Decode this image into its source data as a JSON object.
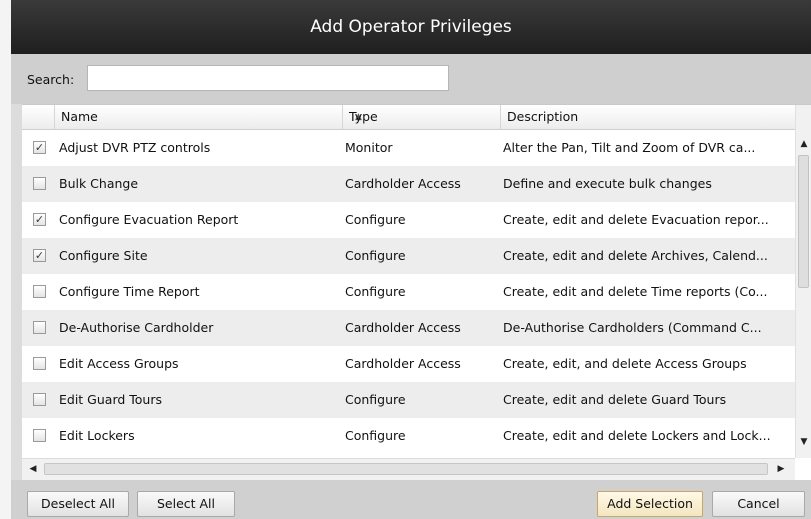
{
  "dialog": {
    "title": "Add Operator Privileges",
    "search": {
      "label": "Search:",
      "value": "",
      "placeholder": ""
    },
    "columns": {
      "name": "Name",
      "type": "Type",
      "description": "Description",
      "sorted_by": "Name",
      "sort_direction": "ascending"
    },
    "rows": [
      {
        "checked": true,
        "name": "Adjust DVR PTZ controls",
        "type": "Monitor",
        "description": "Alter the Pan, Tilt and Zoom of DVR ca..."
      },
      {
        "checked": false,
        "name": "Bulk Change",
        "type": "Cardholder Access",
        "description": "Define and execute bulk changes"
      },
      {
        "checked": true,
        "name": "Configure Evacuation Report",
        "type": "Configure",
        "description": "Create, edit and delete Evacuation repor..."
      },
      {
        "checked": true,
        "name": "Configure Site",
        "type": "Configure",
        "description": "Create, edit and delete Archives, Calend..."
      },
      {
        "checked": false,
        "name": "Configure Time Report",
        "type": "Configure",
        "description": "Create, edit and delete Time reports (Co..."
      },
      {
        "checked": false,
        "name": "De-Authorise Cardholder",
        "type": "Cardholder Access",
        "description": "De-Authorise Cardholders (Command C..."
      },
      {
        "checked": false,
        "name": "Edit Access Groups",
        "type": "Cardholder Access",
        "description": "Create, edit, and delete Access Groups"
      },
      {
        "checked": false,
        "name": "Edit Guard Tours",
        "type": "Configure",
        "description": "Create, edit and delete Guard Tours"
      },
      {
        "checked": false,
        "name": "Edit Lockers",
        "type": "Configure",
        "description": "Create, edit and delete Lockers and Lock..."
      }
    ],
    "buttons": {
      "deselect_all": "Deselect All",
      "select_all": "Select All",
      "add_selection": "Add Selection",
      "cancel": "Cancel"
    },
    "icons": {
      "checkbox_checked": "✓",
      "sort": "sort-ascending-icon",
      "scroll_up": "scroll-up-icon",
      "scroll_down": "scroll-down-icon",
      "scroll_left": "scroll-left-icon",
      "scroll_right": "scroll-right-icon"
    }
  }
}
